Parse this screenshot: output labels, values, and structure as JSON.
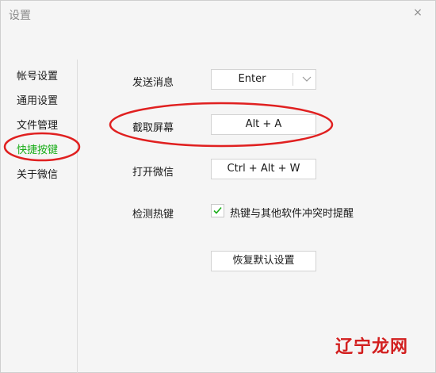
{
  "window": {
    "title": "设置",
    "close_glyph": "×"
  },
  "sidebar": {
    "items": [
      {
        "label": "帐号设置",
        "active": false
      },
      {
        "label": "通用设置",
        "active": false
      },
      {
        "label": "文件管理",
        "active": false
      },
      {
        "label": "快捷按键",
        "active": true
      },
      {
        "label": "关于微信",
        "active": false
      }
    ]
  },
  "shortcuts": {
    "send": {
      "label": "发送消息",
      "value": "Enter"
    },
    "screenshot": {
      "label": "截取屏幕",
      "value": "Alt + A"
    },
    "open": {
      "label": "打开微信",
      "value": "Ctrl + Alt + W"
    },
    "detect": {
      "label": "检测热键",
      "checkbox_label": "热键与其他软件冲突时提醒",
      "checked": true
    },
    "restore_label": "恢复默认设置"
  },
  "watermark": {
    "text": "辽宁龙网"
  },
  "colors": {
    "accent": "#1aad19",
    "annotation": "#e02020"
  }
}
